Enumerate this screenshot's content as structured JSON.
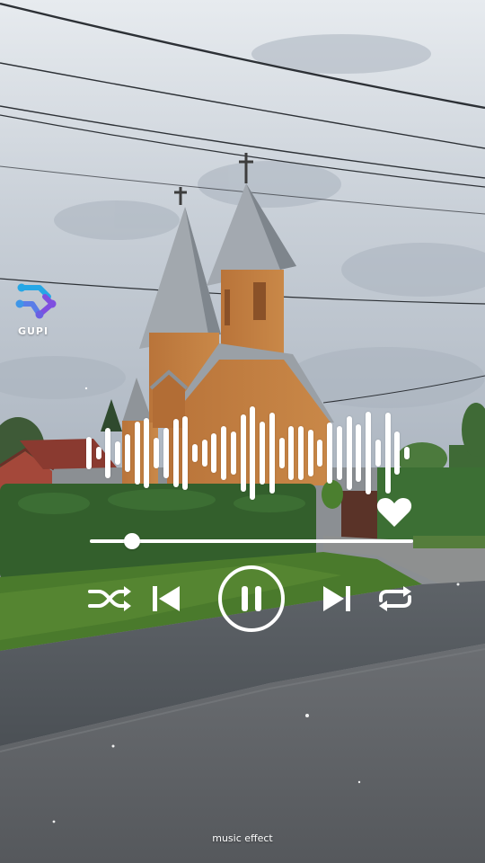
{
  "brand": {
    "name": "GUPI",
    "logo_icon": "molecule-logo-icon"
  },
  "colors": {
    "controls": "#ffffff",
    "logo_blue": "#26a7e6",
    "logo_purple": "#7f4fe0"
  },
  "player": {
    "progress_fraction": 0.13,
    "state": "playing",
    "liked": true,
    "controls": [
      "shuffle-icon",
      "skip-previous-icon",
      "pause-icon",
      "skip-next-icon",
      "repeat-icon"
    ],
    "waveform_levels": [
      0.33,
      0.13,
      0.5,
      0.23,
      0.37,
      0.63,
      0.7,
      0.3,
      0.5,
      0.67,
      0.73,
      0.17,
      0.27,
      0.4,
      0.53,
      0.43,
      0.77,
      0.93,
      0.63,
      0.8,
      0.3,
      0.53,
      0.53,
      0.47,
      0.27,
      0.6,
      0.53,
      0.73,
      0.57,
      0.83,
      0.27,
      0.8,
      0.43,
      0.13
    ]
  },
  "footer": {
    "caption": "music effect"
  }
}
